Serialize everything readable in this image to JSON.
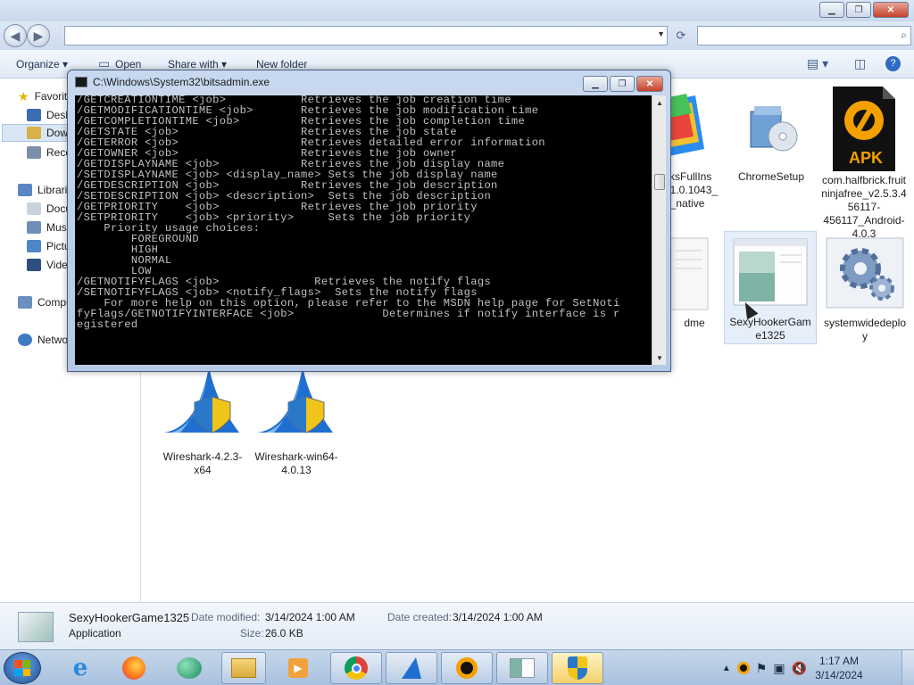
{
  "explorer": {
    "toolbar": {
      "organize": "Organize",
      "open": "Open",
      "share_with": "Share with",
      "new_folder": "New folder"
    },
    "address": "",
    "search_placeholder": ""
  },
  "nav_pane": {
    "items": [
      {
        "label": "Favorites",
        "icon": "star-icon"
      },
      {
        "label": "Desktop",
        "icon": "desktop-icon"
      },
      {
        "label": "Downloads",
        "icon": "downloads-folder-icon"
      },
      {
        "label": "Recent Places",
        "icon": "recent-places-icon"
      },
      {
        "label": "Libraries",
        "icon": "libraries-icon"
      },
      {
        "label": "Documents",
        "icon": "documents-icon"
      },
      {
        "label": "Music",
        "icon": "music-icon"
      },
      {
        "label": "Pictures",
        "icon": "pictures-icon"
      },
      {
        "label": "Videos",
        "icon": "videos-icon"
      },
      {
        "label": "Computer",
        "icon": "computer-icon"
      },
      {
        "label": "Network",
        "icon": "network-icon"
      }
    ]
  },
  "files": [
    {
      "label": "BlueStacksFullInstaller_5.21.0.1043_amd64_native",
      "visible_label": "cksFullIns\n21.0.1043_\n4_native",
      "icon": "bluestacks-icon"
    },
    {
      "label": "ChromeSetup",
      "icon": "installer-cd-icon"
    },
    {
      "label": "com.halfbrick.fruitninjafree_v2.5.3.456117-456117_Android-4.0.3",
      "icon": "apk-icon",
      "badge": "APK"
    },
    {
      "label": "readme",
      "visible_label": "dme",
      "icon": "text-document-icon"
    },
    {
      "label": "SexyHookerGame1325",
      "icon": "application-window-icon"
    },
    {
      "label": "systemwidedeploy",
      "icon": "gears-icon"
    },
    {
      "label": "Wireshark-4.2.3-x64",
      "icon": "wireshark-icon"
    },
    {
      "label": "Wireshark-win64-4.0.13",
      "icon": "wireshark-icon"
    }
  ],
  "details": {
    "name": "SexyHookerGame1325",
    "type": "Application",
    "date_modified_label": "Date modified:",
    "date_modified": "3/14/2024 1:00 AM",
    "date_created_label": "Date created:",
    "date_created": "3/14/2024 1:00 AM",
    "size_label": "Size:",
    "size": "26.0 KB"
  },
  "console": {
    "title": "C:\\Windows\\System32\\bitsadmin.exe",
    "lines": [
      "/GETCREATIONTIME <job>           Retrieves the job creation time",
      "/GETMODIFICATIONTIME <job>       Retrieves the job modification time",
      "/GETCOMPLETIONTIME <job>         Retrieves the job completion time",
      "/GETSTATE <job>                  Retrieves the job state",
      "/GETERROR <job>                  Retrieves detailed error information",
      "/GETOWNER <job>                  Retrieves the job owner",
      "/GETDISPLAYNAME <job>            Retrieves the job display name",
      "/SETDISPLAYNAME <job> <display_name> Sets the job display name",
      "/GETDESCRIPTION <job>            Retrieves the job description",
      "/SETDESCRIPTION <job> <description>  Sets the job description",
      "/GETPRIORITY    <job>            Retrieves the job priority",
      "/SETPRIORITY    <job> <priority>     Sets the job priority",
      "    Priority usage choices:",
      "        FOREGROUND",
      "        HIGH",
      "        NORMAL",
      "        LOW",
      "/GETNOTIFYFLAGS <job>              Retrieves the notify flags",
      "/SETNOTIFYFLAGS <job> <notify_flags>  Sets the notify flags",
      "    For more help on this option, please refer to the MSDN help page for SetNoti",
      "fyFlags/GETNOTIFYINTERFACE <job>             Determines if notify interface is r",
      "egistered"
    ],
    "colors": {
      "background": "#000000",
      "text": "#c0c0c0"
    }
  },
  "taskbar": {
    "apps": [
      {
        "name": "internet-explorer-icon"
      },
      {
        "name": "firefox-icon"
      },
      {
        "name": "windows-media-icon"
      },
      {
        "name": "file-explorer-icon"
      },
      {
        "name": "media-player-icon"
      },
      {
        "name": "chrome-icon"
      },
      {
        "name": "wireshark-icon"
      },
      {
        "name": "apk-installer-icon"
      },
      {
        "name": "application-window-icon"
      },
      {
        "name": "uac-shield-icon"
      }
    ],
    "clock_time": "1:17 AM",
    "clock_date": "3/14/2024"
  }
}
